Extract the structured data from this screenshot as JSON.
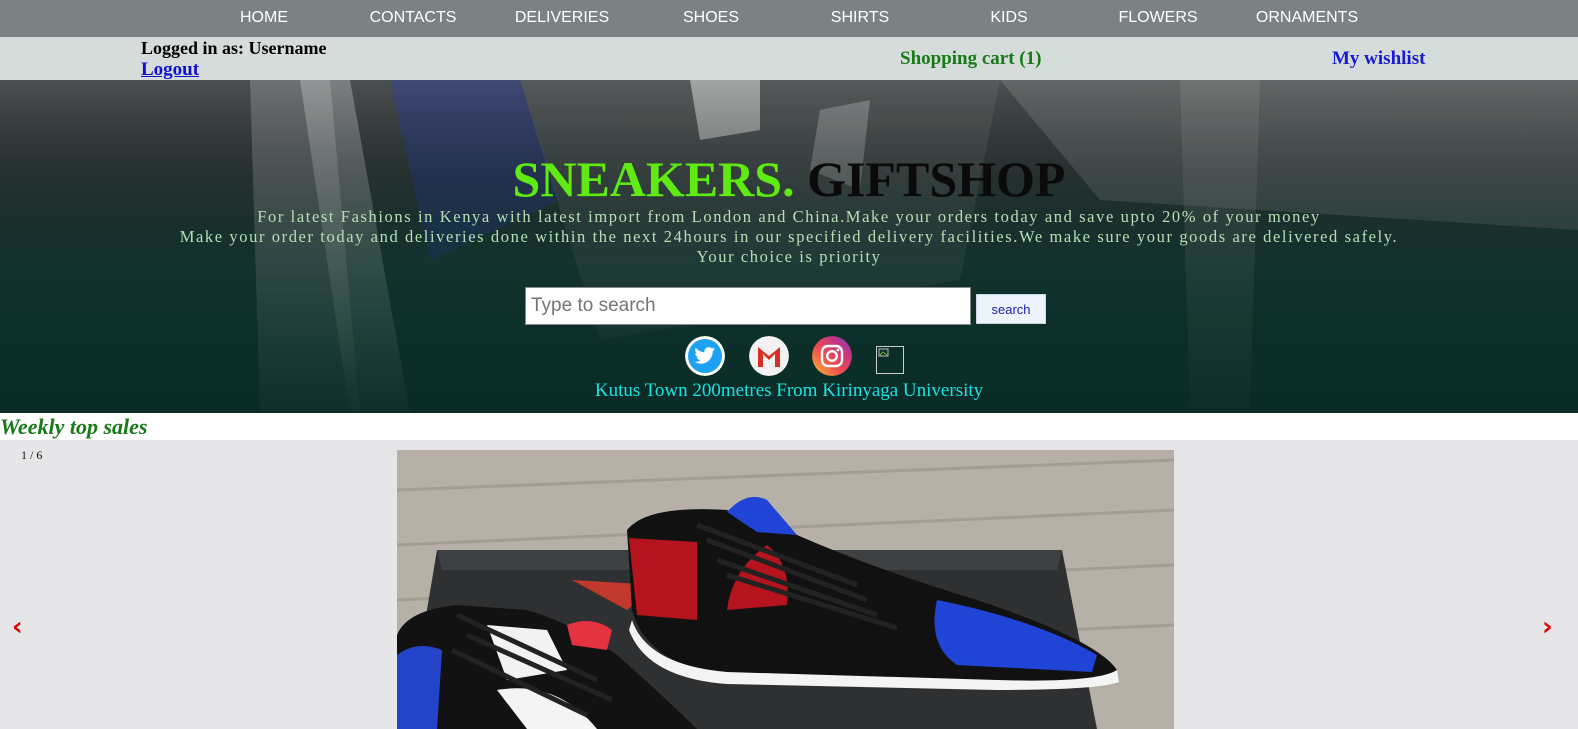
{
  "nav": {
    "items": [
      {
        "label": "HOME"
      },
      {
        "label": "CONTACTS"
      },
      {
        "label": "DELIVERIES"
      },
      {
        "label": "SHOES"
      },
      {
        "label": "SHIRTS"
      },
      {
        "label": "KIDS"
      },
      {
        "label": "FLOWERS"
      },
      {
        "label": "ORNAMENTS"
      }
    ]
  },
  "userbar": {
    "logged_in": "Logged in as: Username",
    "logout": "Logout",
    "cart": "Shopping cart (1)",
    "wishlist": "My wishlist"
  },
  "hero": {
    "brand_part1": "SNEAKERS.",
    "brand_part2": "GIFTSHOP",
    "tagline_lines": [
      "For latest Fashions in Kenya with latest import from London and China.Make your orders today and save upto 20% of your money",
      "Make your order today and deliveries done within the next 24hours in our specified delivery facilities.We make sure your goods are delivered safely.",
      "Your choice is priority"
    ],
    "search": {
      "placeholder": "Type to search",
      "value": "",
      "button": "search"
    },
    "social_icons": [
      "twitter-icon",
      "gmail-icon",
      "instagram-icon",
      "broken-image-icon"
    ],
    "location": "Kutus Town 200metres From Kirinyaga University"
  },
  "weekly": {
    "title": "Weekly top sales",
    "counter": "1 / 6",
    "prev": "‹",
    "next": "›"
  },
  "colors": {
    "nav_bg": "#7b8283",
    "userbar_bg": "#d5dcda",
    "brand_green": "#5fea12",
    "cart_green": "#177a17",
    "wishlist_blue": "#1a1ad0",
    "location_cyan": "#19e3e3",
    "arrow_red": "#e00000"
  }
}
